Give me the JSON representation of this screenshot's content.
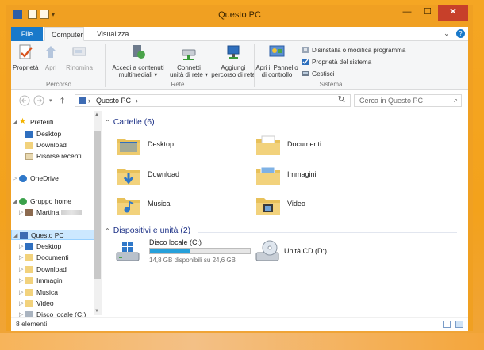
{
  "window": {
    "title": "Questo PC"
  },
  "colors": {
    "accent": "#1979ca",
    "title_bar": "#f0a022",
    "close": "#c7402a",
    "selection": "#cce8ff"
  },
  "ribbon_tabs": [
    {
      "label": "File",
      "icon": null
    },
    {
      "label": "Computer"
    },
    {
      "label": "Visualizza"
    }
  ],
  "ribbon": {
    "groups": [
      {
        "label": "Percorso",
        "buttons": [
          {
            "label": "Proprietà",
            "icon": "properties-check-icon",
            "enabled": true
          },
          {
            "label": "Apri",
            "icon": "open-icon",
            "enabled": false
          },
          {
            "label": "Rinomina",
            "icon": "rename-icon",
            "enabled": false
          }
        ]
      },
      {
        "label": "Rete",
        "buttons": [
          {
            "label": "Accedi a contenuti multimediali ▾",
            "line1": "Accedi a contenuti",
            "line2": "multimediali ▾",
            "icon": "media-access-icon"
          },
          {
            "label": "Connetti unità di rete ▾",
            "line1": "Connetti",
            "line2": "unità di rete ▾",
            "icon": "map-network-drive-icon"
          },
          {
            "label": "Aggiungi percorso di rete",
            "line1": "Aggiungi",
            "line2": "percorso di rete",
            "icon": "add-network-location-icon"
          }
        ]
      },
      {
        "label": "Sistema",
        "buttons": [
          {
            "label": "Apri il Pannello di controllo",
            "line1": "Apri il Pannello",
            "line2": "di controllo",
            "icon": "control-panel-icon"
          }
        ],
        "items": [
          {
            "label": "Disinstalla o modifica programma",
            "icon": "uninstall-icon"
          },
          {
            "label": "Proprietà del sistema",
            "icon": "system-properties-icon"
          },
          {
            "label": "Gestisci",
            "icon": "manage-icon"
          }
        ]
      }
    ]
  },
  "address": {
    "location": "Questo PC",
    "search_placeholder": "Cerca in Questo PC"
  },
  "nav_pane": {
    "items": [
      {
        "label": "Preferiti",
        "icon": "star-icon"
      },
      {
        "label": "Desktop",
        "icon": "desktop-icon"
      },
      {
        "label": "Download",
        "icon": "download-folder-icon"
      },
      {
        "label": "Risorse recenti",
        "icon": "recent-places-icon"
      },
      {
        "label": "OneDrive",
        "icon": "onedrive-icon"
      },
      {
        "label": "Gruppo home",
        "icon": "homegroup-icon"
      },
      {
        "label": "Martina",
        "icon": "user-icon"
      },
      {
        "label": "Questo PC",
        "icon": "computer-icon",
        "selected": true
      },
      {
        "label": "Desktop",
        "icon": "desktop-icon"
      },
      {
        "label": "Documenti",
        "icon": "documents-icon"
      },
      {
        "label": "Download",
        "icon": "download-folder-icon"
      },
      {
        "label": "Immagini",
        "icon": "pictures-icon"
      },
      {
        "label": "Musica",
        "icon": "music-icon"
      },
      {
        "label": "Video",
        "icon": "video-icon"
      },
      {
        "label": "Disco locale (C:)",
        "icon": "drive-icon"
      }
    ]
  },
  "content": {
    "folders_header": "Cartelle (6)",
    "folders": [
      {
        "label": "Desktop",
        "icon": "desktop-folder-icon"
      },
      {
        "label": "Documenti",
        "icon": "documents-folder-icon"
      },
      {
        "label": "Download",
        "icon": "download-folder-icon"
      },
      {
        "label": "Immagini",
        "icon": "pictures-folder-icon"
      },
      {
        "label": "Musica",
        "icon": "music-folder-icon"
      },
      {
        "label": "Video",
        "icon": "video-folder-icon"
      }
    ],
    "drives_header": "Dispositivi e unità (2)",
    "drives": [
      {
        "label": "Disco locale (C:)",
        "free_text": "14,8 GB disponibili su 24,6 GB",
        "used_fraction": 0.4,
        "icon": "windows-drive-icon"
      },
      {
        "label": "Unità CD (D:)",
        "icon": "cd-drive-icon"
      }
    ]
  },
  "status": {
    "items_count": "8 elementi"
  }
}
